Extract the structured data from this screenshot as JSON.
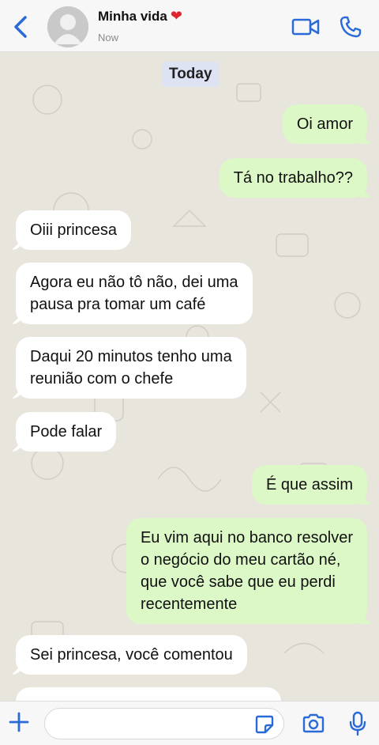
{
  "header": {
    "contact_name": "Minha vida",
    "heart": "❤",
    "status": "Now"
  },
  "chat": {
    "date_chip": "Today",
    "messages": [
      {
        "direction": "out",
        "text": "Oi amor"
      },
      {
        "direction": "out",
        "text": "Tá no trabalho??"
      },
      {
        "direction": "in",
        "text": "Oiii princesa"
      },
      {
        "direction": "in",
        "text": "Agora eu não tô não, dei uma\npausa pra tomar um café"
      },
      {
        "direction": "in",
        "text": "Daqui 20 minutos tenho uma\nreunião com o chefe"
      },
      {
        "direction": "in",
        "text": "Pode falar"
      },
      {
        "direction": "out",
        "text": "É que assim"
      },
      {
        "direction": "out",
        "text": "Eu vim aqui no banco resolver\no negócio do meu cartão né,\nque você sabe que eu perdi\nrecentemente"
      },
      {
        "direction": "in",
        "text": "Sei princesa, você comentou"
      },
      {
        "direction": "in",
        "text": ""
      }
    ]
  },
  "colors": {
    "accent": "#2a6ad8",
    "outgoing_bubble": "#dcf8c6",
    "incoming_bubble": "#ffffff",
    "date_chip": "#dde3f3",
    "heart": "#e0242c"
  },
  "icons": {
    "back": "chevron-left-icon",
    "video": "video-camera-icon",
    "call": "phone-icon",
    "plus": "plus-icon",
    "sticker": "sticker-icon",
    "camera": "camera-icon",
    "mic": "microphone-icon"
  }
}
